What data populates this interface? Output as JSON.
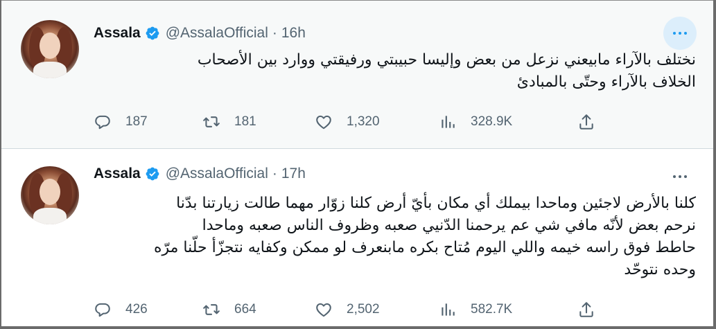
{
  "colors": {
    "text": "#0f1419",
    "secondary": "#536471",
    "verified_blue": "#1d9bf0",
    "highlight_bg": "#f7f9f9",
    "more_hover_bg": "#dceefb"
  },
  "icons": {
    "verified": "verified-badge-icon",
    "more": "more-options-icon",
    "reply": "reply-icon",
    "retweet": "retweet-icon",
    "like": "heart-icon",
    "views": "views-bar-chart-icon",
    "share": "share-icon"
  },
  "tweets": [
    {
      "author_name": "Assala",
      "handle": "@AssalaOfficial",
      "separator": "·",
      "time": "16h",
      "lines": [
        "نختلف بالآراء مابيعني نزعل من بعض وإليسا حبيبتي ورفيقتي ووارد بين الأصحاب",
        "الخلاف بالآراء وحتّى بالمبادئ"
      ],
      "replies": "187",
      "retweets": "181",
      "likes": "1,320",
      "views": "328.9K"
    },
    {
      "author_name": "Assala",
      "handle": "@AssalaOfficial",
      "separator": "·",
      "time": "17h",
      "lines": [
        "كلنا بالأرض لاجئين وماحدا بيملك أي مكان بأيّ أرض كلنا زوّار مهما طالت زيارتنا بدّنا",
        "نرحم بعض لأنّه مافي شي عم يرحمنا الدّنيي صعبه وظروف الناس صعبه وماحدا",
        "حاطط فوق راسه خيمه واللي اليوم مُتاح بكره مابنعرف لو ممكن وكفايه نتجزّأ حلّنا مرّه",
        "وحده نتوحّد"
      ],
      "replies": "426",
      "retweets": "664",
      "likes": "2,502",
      "views": "582.7K"
    }
  ]
}
